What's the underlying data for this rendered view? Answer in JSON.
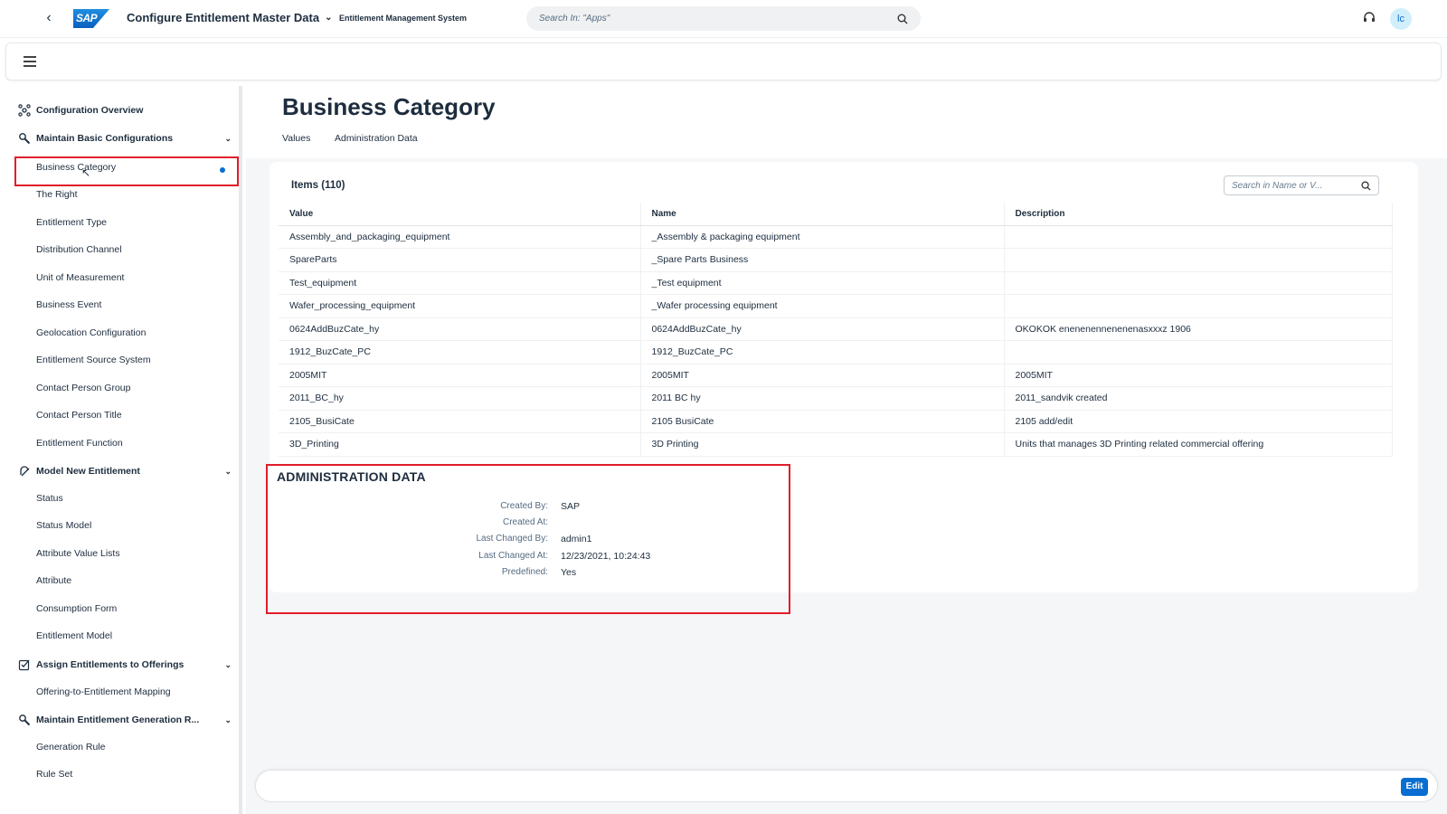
{
  "shell": {
    "logo_text": "SAP",
    "app_title": "Configure Entitlement Master Data",
    "system_title": "Entitlement Management System",
    "search_placeholder": "Search In: \"Apps\"",
    "avatar_initials": "lc"
  },
  "sidenav": {
    "groups": [
      {
        "label": "Configuration Overview",
        "icon": "overview-icon"
      },
      {
        "label": "Maintain Basic Configurations",
        "icon": "wrench-icon"
      },
      {
        "label": "Model New Entitlement",
        "icon": "model-icon"
      },
      {
        "label": "Assign Entitlements to Offerings",
        "icon": "assign-icon"
      },
      {
        "label": "Maintain Entitlement Generation R...",
        "icon": "wrench-icon"
      }
    ],
    "basic_items": [
      "Business Category",
      "The Right",
      "Entitlement Type",
      "Distribution Channel",
      "Unit of Measurement",
      "Business Event",
      "Geolocation Configuration",
      "Entitlement Source System",
      "Contact Person Group",
      "Contact Person Title",
      "Entitlement Function"
    ],
    "model_items": [
      "Status",
      "Status Model",
      "Attribute Value Lists",
      "Attribute",
      "Consumption Form",
      "Entitlement Model"
    ],
    "assign_items": [
      "Offering-to-Entitlement Mapping"
    ],
    "generation_items": [
      "Generation Rule",
      "Rule Set"
    ],
    "selected": "Business Category"
  },
  "page": {
    "title": "Business Category",
    "tabs": [
      "Values",
      "Administration Data"
    ]
  },
  "table": {
    "title": "Items (110)",
    "search_placeholder": "Search in Name or V...",
    "columns": [
      "Value",
      "Name",
      "Description"
    ],
    "rows": [
      [
        "Assembly_and_packaging_equipment",
        "_Assembly & packaging equipment",
        ""
      ],
      [
        "SpareParts",
        "_Spare Parts Business",
        ""
      ],
      [
        "Test_equipment",
        "_Test equipment",
        ""
      ],
      [
        "Wafer_processing_equipment",
        "_Wafer processing equipment",
        ""
      ],
      [
        "0624AddBuzCate_hy",
        "0624AddBuzCate_hy",
        "OKOKOK  enenenennenenenasxxxz 1906"
      ],
      [
        "1912_BuzCate_PC",
        "1912_BuzCate_PC",
        ""
      ],
      [
        "2005MIT",
        "2005MIT",
        "2005MIT"
      ],
      [
        "2011_BC_hy",
        "2011 BC hy",
        "2011_sandvik created"
      ],
      [
        "2105_BusiCate",
        "2105 BusiCate",
        "2105 add/edit"
      ],
      [
        "3D_Printing",
        "3D Printing",
        "Units that manages 3D Printing related commercial offering"
      ]
    ]
  },
  "admin": {
    "title": "ADMINISTRATION DATA",
    "fields": [
      {
        "label": "Created By:",
        "value": "SAP"
      },
      {
        "label": "Created At:",
        "value": ""
      },
      {
        "label": "Last Changed By:",
        "value": "admin1"
      },
      {
        "label": "Last Changed At:",
        "value": "12/23/2021, 10:24:43"
      },
      {
        "label": "Predefined:",
        "value": "Yes"
      }
    ]
  },
  "footer": {
    "edit_label": "Edit"
  },
  "colors": {
    "accent": "#0a6ed1",
    "highlight": "#e01d2a"
  }
}
